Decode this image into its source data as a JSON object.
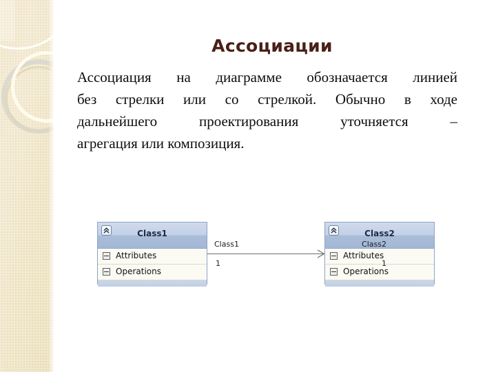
{
  "slide": {
    "title": "Ассоциации",
    "body_lines": [
      "Ассоциация на диаграмме обозначается линией",
      "без стрелки или со стрелкой. Обычно в ходе",
      "дальнейшего проектирования уточняется  –",
      "агрегация или композиция."
    ],
    "body_full": "Ассоциация на диаграмме обозначается линией без стрелки или со стрелкой. Обычно в ходе дальнейшего проектирования уточняется – агрегация или композиция."
  },
  "colors": {
    "title": "#4a1f16",
    "body": "#0d0d0d",
    "band_light": "#efe3c4",
    "band_dark": "#e8dbb4",
    "uml_header_top": "#cfdaeb",
    "uml_header_bottom": "#a3b8d6",
    "uml_body": "#fbfbf4",
    "uml_border": "#8ea3c4",
    "assoc_line": "#6d6d6d"
  },
  "diagram": {
    "type": "uml-class-diagram",
    "classes": [
      {
        "name": "Class1",
        "collapse_icon": "double-chevron-up-icon",
        "compartments": [
          {
            "label": "Attributes",
            "toggle": "minus-box-icon"
          },
          {
            "label": "Operations",
            "toggle": "minus-box-icon"
          }
        ]
      },
      {
        "name": "Class2",
        "collapse_icon": "double-chevron-up-icon",
        "compartments": [
          {
            "label": "Attributes",
            "toggle": "minus-box-icon"
          },
          {
            "label": "Operations",
            "toggle": "minus-box-icon"
          }
        ]
      }
    ],
    "association": {
      "source_role": "Class1",
      "target_role": "Class2",
      "source_multiplicity": "1",
      "target_multiplicity": "1",
      "arrow": "open-arrow-right-icon",
      "direction": "left-to-right"
    }
  }
}
